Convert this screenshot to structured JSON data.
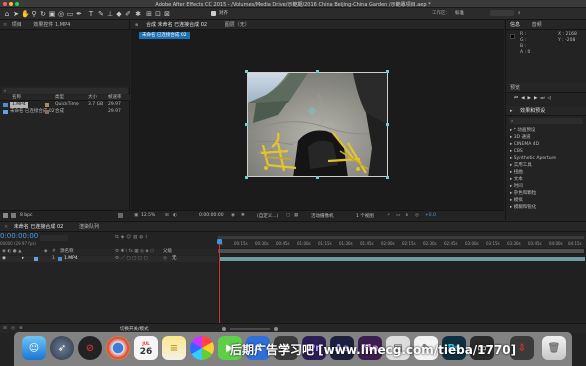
{
  "window": {
    "title": "Adobe After Effects CC 2015 - /Volumes/Media Drive/示範期/2016 China Beijing-China Garden /示範專項目.aep *"
  },
  "toolbar": {
    "snap_label": "对齐",
    "workspace_label": "工作区:",
    "workspace_value": "标准"
  },
  "project": {
    "tab": "项目",
    "effect_controls_tab": "效果控件 1.MP4",
    "search_placeholder": "",
    "columns": {
      "name": "名称",
      "type": "类型",
      "size": "大小",
      "fps": "帧速率"
    },
    "items": [
      {
        "name": "1.MP4",
        "type": "QuickTime",
        "size": "3.7 GB",
        "fps": "29.97"
      },
      {
        "name": "未命名 已连接合成 02",
        "type": "合成",
        "size": "",
        "fps": "29.97"
      }
    ],
    "bpc": "8 bpc"
  },
  "composition": {
    "tab": "合成 未命名 已连接合成 02",
    "layer_tab": "图层（无）",
    "comp_chip": "未命名 已连接合成 02",
    "zoom": "12.5%",
    "timecode": "0:00:00:00",
    "resolution": "(自定义...)",
    "camera": "活动摄像机",
    "views": "1 个视图",
    "exposure": "+0.0"
  },
  "info": {
    "tab": "信息",
    "audio_tab": "音频",
    "r": "R :",
    "g": "G :",
    "b": "B :",
    "a": "A : 0",
    "x": "X : 2168",
    "y": "Y : -208"
  },
  "preview": {
    "tab": "预览",
    "effects_tab": "效果和预设"
  },
  "effects": {
    "search_placeholder": "",
    "items": [
      "* 动画预设",
      "3D 通道",
      "CINEMA 4D",
      "CBS",
      "Synthetic Aperture",
      "实用工具",
      "扭曲",
      "文本",
      "时间",
      "杂色和颗粒",
      "模拟",
      "模糊和锐化"
    ]
  },
  "timeline": {
    "tab": "未命名 已连接合成 02",
    "render_tab": "渲染队列",
    "timecode": "0:00:00:00",
    "fps_label": "00000 (29.97 fps)",
    "source_label": "源名称",
    "parent_label": "父级",
    "layer_number": "1",
    "layer_name": "1.MP4",
    "parent_value": "无",
    "toggle_label": "切换开关/模式",
    "ruler": [
      "00:15s",
      "00:30s",
      "00:45s",
      "01:00s",
      "01:15s",
      "01:30s",
      "01:45s",
      "02:00s",
      "02:15s",
      "02:30s",
      "02:45s",
      "03:00s",
      "03:15s",
      "03:30s",
      "03:45s",
      "04:00s",
      "04:15s"
    ]
  },
  "dock": {
    "calendar_day": "26",
    "calendar_month": "JUL",
    "watermark": "后期广告学习吧  [www.linecg.com/tieba/1770]"
  },
  "colors": {
    "accent_blue": "#2d8ceb",
    "comp_chip": "#1f6fb5",
    "timeline_track": "#6f9c9e",
    "playhead": "#3c93e6"
  }
}
